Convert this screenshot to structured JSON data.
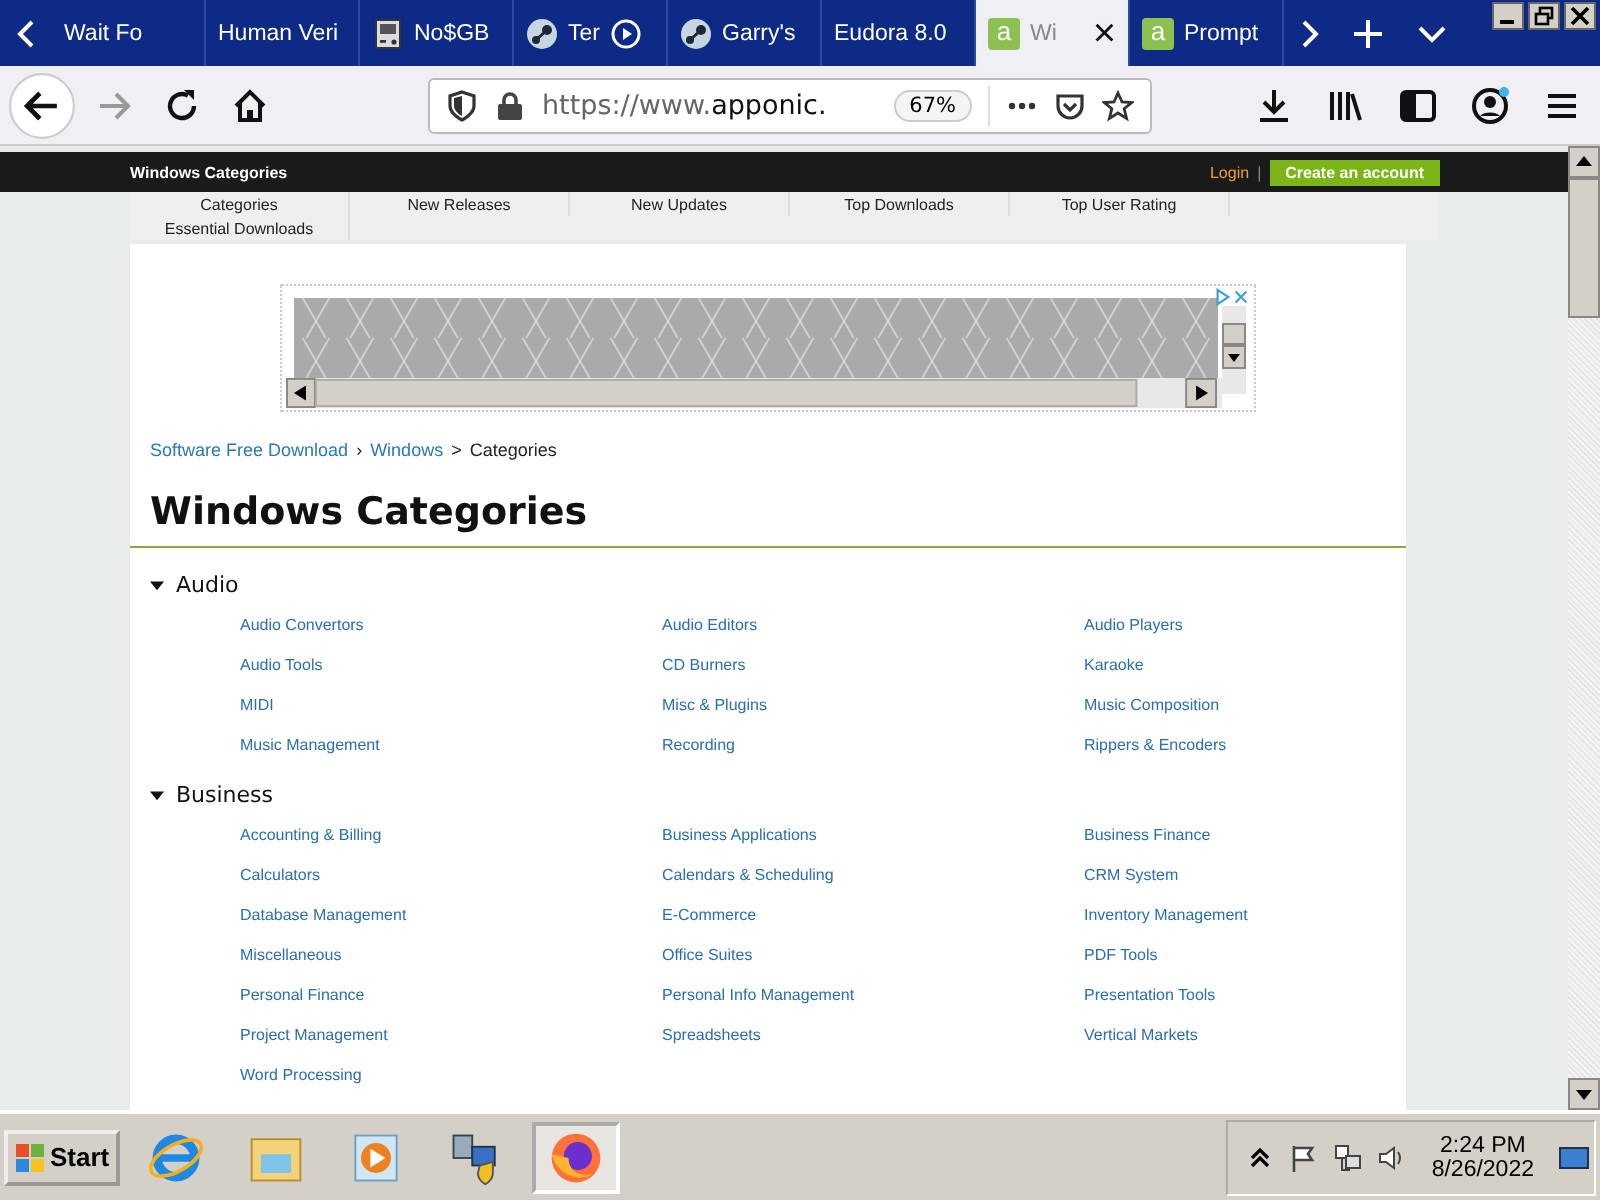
{
  "browser": {
    "tabs": [
      {
        "title": "Wait Fo",
        "kind": "plain",
        "playing": false,
        "selected": false
      },
      {
        "title": "Human Veri",
        "kind": "plain",
        "playing": false,
        "selected": false
      },
      {
        "title": "No$GB",
        "kind": "console",
        "playing": false,
        "selected": false
      },
      {
        "title": "Ter",
        "kind": "steam",
        "playing": true,
        "selected": false
      },
      {
        "title": "Garry's",
        "kind": "steam",
        "playing": false,
        "selected": false
      },
      {
        "title": "Eudora 8.0",
        "kind": "plain",
        "playing": false,
        "selected": false
      },
      {
        "title": "Wi",
        "kind": "lettered",
        "logo_text": "a",
        "playing": false,
        "selected": true
      },
      {
        "title": "Prompt",
        "kind": "lettered",
        "logo_text": "a",
        "playing": false,
        "selected": false
      }
    ],
    "tab_close": "×",
    "url_prefix": "https://www.",
    "url_host": "apponic.",
    "zoom": "67%"
  },
  "site": {
    "header_title": "Windows Categories",
    "login": "Login",
    "login_separator": "|",
    "create_account": "Create an account",
    "nav": [
      "Categories",
      "New Releases",
      "New Updates",
      "Top Downloads",
      "Top User Rating",
      "Essential Downloads"
    ],
    "breadcrumb": [
      {
        "text": "Software Free Download",
        "link": true
      },
      {
        "text": "›",
        "link": false
      },
      {
        "text": "Windows",
        "link": true
      },
      {
        "text": ">",
        "link": false
      },
      {
        "text": "Categories",
        "link": false
      }
    ],
    "heading": "Windows Categories",
    "sections": [
      {
        "title": "Audio",
        "expanded": true,
        "items": [
          "Audio Convertors",
          "Audio Editors",
          "Audio Players",
          "Audio Tools",
          "CD Burners",
          "Karaoke",
          "MIDI",
          "Misc & Plugins",
          "Music Composition",
          "Music Management",
          "Recording",
          "Rippers & Encoders"
        ]
      },
      {
        "title": "Business",
        "expanded": true,
        "items": [
          "Accounting & Billing",
          "Business Applications",
          "Business Finance",
          "Calculators",
          "Calendars & Scheduling",
          "CRM System",
          "Database Management",
          "E-Commerce",
          "Inventory Management",
          "Miscellaneous",
          "Office Suites",
          "PDF Tools",
          "Personal Finance",
          "Personal Info Management",
          "Presentation Tools",
          "Project Management",
          "Spreadsheets",
          "Vertical Markets",
          "Word Processing"
        ]
      }
    ]
  },
  "taskbar": {
    "start": "Start",
    "apps": [
      {
        "kind": "ie",
        "selected": false
      },
      {
        "kind": "explorer",
        "selected": false
      },
      {
        "kind": "media",
        "selected": false
      },
      {
        "kind": "server",
        "selected": false
      },
      {
        "kind": "firefox",
        "selected": true
      }
    ],
    "time": "2:24 PM",
    "date": "8/26/2022"
  }
}
